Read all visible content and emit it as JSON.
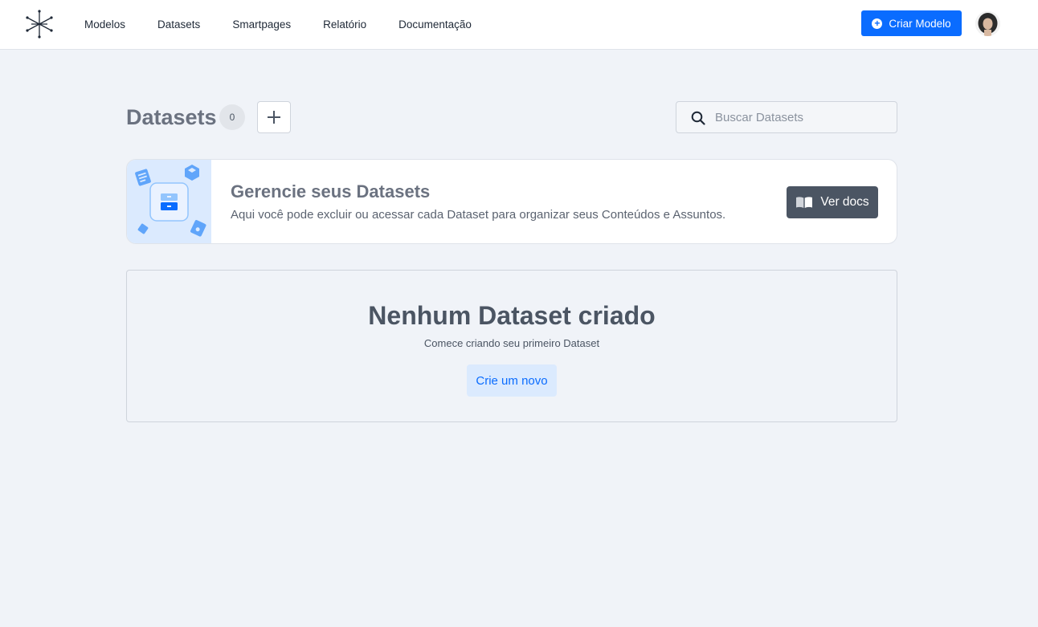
{
  "nav": {
    "items": [
      "Modelos",
      "Datasets",
      "Smartpages",
      "Relatório",
      "Documentação"
    ],
    "create_model_label": "Criar Modelo"
  },
  "header": {
    "title": "Datasets",
    "count": "0",
    "search_placeholder": "Buscar Datasets"
  },
  "info": {
    "title": "Gerencie seus Datasets",
    "description": "Aqui você pode excluir ou acessar cada Dataset para organizar seus Conteúdos e Assuntos.",
    "docs_label": "Ver docs"
  },
  "empty": {
    "title": "Nenhum Dataset criado",
    "subtitle": "Comece criando seu primeiro Dataset",
    "button_label": "Crie um novo"
  },
  "colors": {
    "primary": "#0a6cff",
    "background": "#f0f3f8",
    "dark_button": "#4b5563",
    "light_blue": "#dbeafe"
  },
  "icons": [
    "logo-icon",
    "plus-circle-icon",
    "avatar",
    "plus-icon",
    "search-icon",
    "book-icon",
    "dataset-illustration"
  ]
}
